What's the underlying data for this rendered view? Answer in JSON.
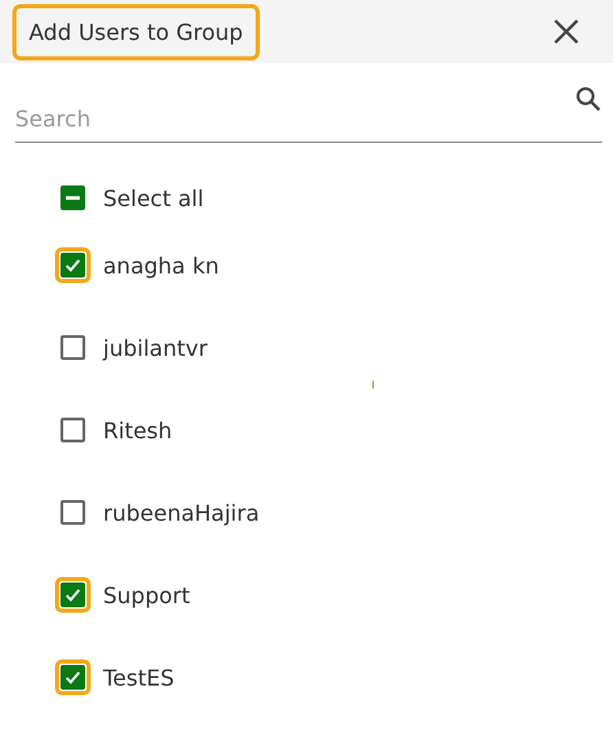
{
  "dialog": {
    "title": "Add Users to Group",
    "title_highlighted": true
  },
  "search": {
    "placeholder": "Search"
  },
  "select_all": {
    "label": "Select all",
    "indeterminate": true
  },
  "users": [
    {
      "name": "anagha kn",
      "checked": true,
      "highlighted": true
    },
    {
      "name": "jubilantvr",
      "checked": false,
      "highlighted": false
    },
    {
      "name": "Ritesh",
      "checked": false,
      "highlighted": false
    },
    {
      "name": "rubeenaHajira",
      "checked": false,
      "highlighted": false
    },
    {
      "name": "Support",
      "checked": true,
      "highlighted": true
    },
    {
      "name": "TestES",
      "checked": true,
      "highlighted": true
    }
  ]
}
